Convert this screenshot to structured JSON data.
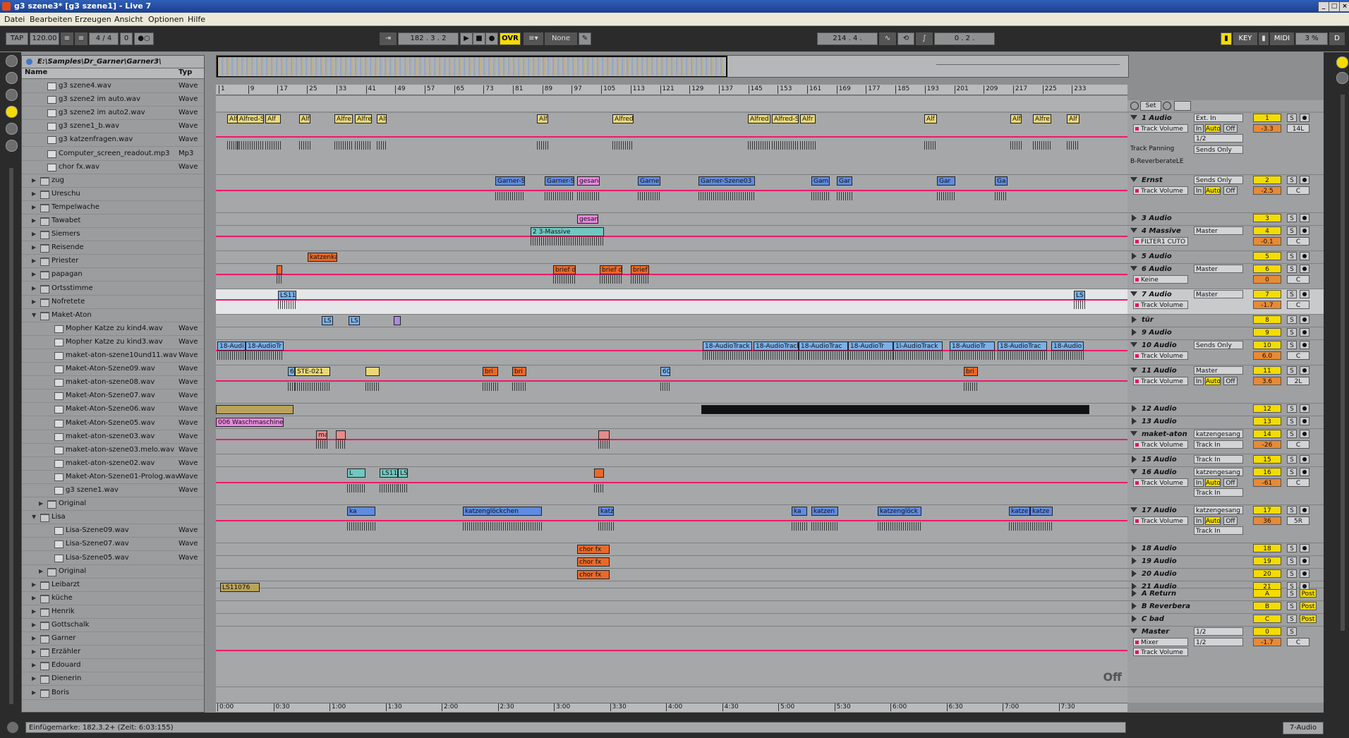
{
  "window": {
    "title": "g3 szene3*  [g3 szene1] - Live 7"
  },
  "menu": [
    "Datei",
    "Bearbeiten",
    "Erzeugen",
    "Ansicht",
    "Optionen",
    "Hilfe"
  ],
  "control": {
    "tap": "TAP",
    "tempo": "120.00",
    "signature": "4 / 4",
    "nudge": "0",
    "position": "182 .  3 .  2",
    "ovr": "OVR",
    "quantize": "None",
    "loop_start": "214 .  4 .",
    "loop_length": "0 .  2 .",
    "key": "KEY",
    "midi": "MIDI",
    "cpu": "3 %",
    "d": "D"
  },
  "browser": {
    "path": "E:\\Samples\\Dr_Garner\\Garner3\\",
    "col_name": "Name",
    "col_type": "Typ",
    "rows": [
      {
        "n": "g3 szene4.wav",
        "t": "Wave",
        "k": "file",
        "i": 2
      },
      {
        "n": "g3 szene2 im auto.wav",
        "t": "Wave",
        "k": "file",
        "i": 2
      },
      {
        "n": "g3 szene2 im auto2.wav",
        "t": "Wave",
        "k": "file",
        "i": 2
      },
      {
        "n": "g3 szene1_b.wav",
        "t": "Wave",
        "k": "file",
        "i": 2
      },
      {
        "n": "g3 katzenfragen.wav",
        "t": "Wave",
        "k": "file",
        "i": 2
      },
      {
        "n": "Computer_screen_readout.mp3",
        "t": "Mp3",
        "k": "file",
        "i": 2
      },
      {
        "n": "chor fx.wav",
        "t": "Wave",
        "k": "file",
        "i": 2
      },
      {
        "n": "zug",
        "t": "",
        "k": "fold",
        "i": 1
      },
      {
        "n": "Ureschu",
        "t": "",
        "k": "fold",
        "i": 1
      },
      {
        "n": "Tempelwache",
        "t": "",
        "k": "fold",
        "i": 1
      },
      {
        "n": "Tawabet",
        "t": "",
        "k": "fold",
        "i": 1
      },
      {
        "n": "Siemers",
        "t": "",
        "k": "fold",
        "i": 1
      },
      {
        "n": "Reisende",
        "t": "",
        "k": "fold",
        "i": 1
      },
      {
        "n": "Priester",
        "t": "",
        "k": "fold",
        "i": 1
      },
      {
        "n": "papagan",
        "t": "",
        "k": "fold",
        "i": 1
      },
      {
        "n": "Ortsstimme",
        "t": "",
        "k": "fold",
        "i": 1
      },
      {
        "n": "Nofretete",
        "t": "",
        "k": "fold",
        "i": 1
      },
      {
        "n": "Maket-Aton",
        "t": "",
        "k": "open",
        "i": 1
      },
      {
        "n": "Mopher Katze zu kind4.wav",
        "t": "Wave",
        "k": "file",
        "i": 3
      },
      {
        "n": "Mopher Katze zu kind3.wav",
        "t": "Wave",
        "k": "file",
        "i": 3
      },
      {
        "n": "maket-aton-szene10und11.wav",
        "t": "Wave",
        "k": "file",
        "i": 3
      },
      {
        "n": "Maket-Aton-Szene09.wav",
        "t": "Wave",
        "k": "file",
        "i": 3
      },
      {
        "n": "maket-aton-szene08.wav",
        "t": "Wave",
        "k": "file",
        "i": 3
      },
      {
        "n": "Maket-Aton-Szene07.wav",
        "t": "Wave",
        "k": "file",
        "i": 3
      },
      {
        "n": "Maket-Aton-Szene06.wav",
        "t": "Wave",
        "k": "file",
        "i": 3
      },
      {
        "n": "Maket-Aton-Szene05.wav",
        "t": "Wave",
        "k": "file",
        "i": 3
      },
      {
        "n": "maket-aton-szene03.wav",
        "t": "Wave",
        "k": "file",
        "i": 3
      },
      {
        "n": "maket-aton-szene03.melo.wav",
        "t": "Wave",
        "k": "file",
        "i": 3
      },
      {
        "n": "maket-aton-szene02.wav",
        "t": "Wave",
        "k": "file",
        "i": 3
      },
      {
        "n": "Maket-Aton-Szene01-Prolog.wav",
        "t": "Wave",
        "k": "file",
        "i": 3
      },
      {
        "n": "g3 szene1.wav",
        "t": "Wave",
        "k": "file",
        "i": 3
      },
      {
        "n": "Original",
        "t": "",
        "k": "fold",
        "i": 2
      },
      {
        "n": "Lisa",
        "t": "",
        "k": "open",
        "i": 1
      },
      {
        "n": "Lisa-Szene09.wav",
        "t": "Wave",
        "k": "file",
        "i": 3
      },
      {
        "n": "Lisa-Szene07.wav",
        "t": "Wave",
        "k": "file",
        "i": 3
      },
      {
        "n": "Lisa-Szene05.wav",
        "t": "Wave",
        "k": "file",
        "i": 3
      },
      {
        "n": "Original",
        "t": "",
        "k": "fold",
        "i": 2
      },
      {
        "n": "Leibarzt",
        "t": "",
        "k": "fold",
        "i": 1
      },
      {
        "n": "küche",
        "t": "",
        "k": "fold",
        "i": 1
      },
      {
        "n": "Henrik",
        "t": "",
        "k": "fold",
        "i": 1
      },
      {
        "n": "Gottschalk",
        "t": "",
        "k": "fold",
        "i": 1
      },
      {
        "n": "Garner",
        "t": "",
        "k": "fold",
        "i": 1
      },
      {
        "n": "Erzähler",
        "t": "",
        "k": "fold",
        "i": 1
      },
      {
        "n": "Edouard",
        "t": "",
        "k": "fold",
        "i": 1
      },
      {
        "n": "Dienerin",
        "t": "",
        "k": "fold",
        "i": 1
      },
      {
        "n": "Boris",
        "t": "",
        "k": "fold",
        "i": 1
      }
    ]
  },
  "ruler_bars": [
    "1",
    "9",
    "17",
    "25",
    "33",
    "41",
    "49",
    "57",
    "65",
    "73",
    "81",
    "89",
    "97",
    "105",
    "113",
    "121",
    "129",
    "137",
    "145",
    "153",
    "161",
    "169",
    "177",
    "185",
    "193",
    "201",
    "209",
    "217",
    "225",
    "233"
  ],
  "time_ruler": [
    "0:00",
    "0:30",
    "1:00",
    "1:30",
    "2:00",
    "2:30",
    "3:00",
    "3:30",
    "4:00",
    "4:30",
    "5:00",
    "5:30",
    "6:00",
    "6:30",
    "7:00",
    "7:30"
  ],
  "set_label": "Set",
  "tracks": [
    {
      "name": "1 Audio",
      "h": 88,
      "num": "1",
      "io": "Ext. In",
      "io2": "1/2",
      "vol": "-3.3",
      "pan": "14L",
      "auto": "Track Volume",
      "mon": true,
      "extra": [
        "Track Panning",
        "B-ReverberateLE"
      ],
      "sends": "Sends Only",
      "clips": [
        [
          "Alf",
          16,
          18,
          "#e9d87a"
        ],
        [
          "Alfred-S",
          30,
          38,
          "#e9d87a"
        ],
        [
          "Alf",
          70,
          22,
          "#e9d87a"
        ],
        [
          "Alf",
          118,
          16,
          "#e9d87a"
        ],
        [
          "Alfre",
          168,
          26,
          "#e9d87a"
        ],
        [
          "Alfre",
          197,
          24,
          "#e9d87a"
        ],
        [
          "Alf",
          228,
          14,
          "#e9d87a"
        ],
        [
          "Alf",
          455,
          16,
          "#e9d87a"
        ],
        [
          "Alfred",
          562,
          30,
          "#e9d87a"
        ],
        [
          "Alfred",
          754,
          32,
          "#e9d87a"
        ],
        [
          "Alfred-S",
          788,
          38,
          "#e9d87a"
        ],
        [
          "Alfr",
          828,
          22,
          "#e9d87a"
        ],
        [
          "Alf",
          1004,
          18,
          "#e9d87a"
        ],
        [
          "Alf",
          1126,
          16,
          "#e9d87a"
        ],
        [
          "Alfre",
          1158,
          26,
          "#e9d87a"
        ],
        [
          "Alf",
          1206,
          18,
          "#e9d87a"
        ]
      ]
    },
    {
      "name": "Ernst",
      "h": 54,
      "num": "2",
      "io": "Sends Only",
      "vol": "-2.5",
      "pan": "C",
      "auto": "Track Volume",
      "mon": true,
      "clips": [
        [
          "Garner-S",
          396,
          42,
          "#5f8be0"
        ],
        [
          "Garner-S",
          466,
          42,
          "#5f8be0"
        ],
        [
          "gesang",
          512,
          32,
          "#e88adf"
        ],
        [
          "Garne",
          598,
          32,
          "#5f8be0"
        ],
        [
          "Garner-Szene03",
          684,
          80,
          "#5f8be0"
        ],
        [
          "Gam",
          844,
          26,
          "#5f8be0"
        ],
        [
          "Gar",
          880,
          22,
          "#5f8be0"
        ],
        [
          "Gar",
          1022,
          26,
          "#5f8be0"
        ],
        [
          "Ga",
          1104,
          18,
          "#5f8be0"
        ]
      ]
    },
    {
      "name": "3 Audio",
      "h": 18,
      "num": "3",
      "io": "",
      "clips": [
        [
          "gesan",
          512,
          30,
          "#e88adf"
        ]
      ]
    },
    {
      "name": "4 Massive",
      "h": 36,
      "num": "4",
      "io": "Master",
      "vol": "-0.1",
      "pan": "C",
      "auto": "FILTER1 CUTO",
      "clips": [
        [
          "2 3-Massive",
          446,
          104,
          "#6fc8c0"
        ]
      ]
    },
    {
      "name": "5 Audio",
      "h": 18,
      "num": "5",
      "io": "",
      "clips": [
        [
          "katzenkatze",
          130,
          42,
          "#e8692a"
        ]
      ]
    },
    {
      "name": "6 Audio",
      "h": 36,
      "num": "6",
      "io": "Master",
      "vol": "0",
      "pan": "C",
      "auto": "Keine",
      "clips": [
        [
          "",
          86,
          8,
          "#e8692a"
        ],
        [
          "brief d",
          478,
          32,
          "#e8692a"
        ],
        [
          "brief d",
          544,
          32,
          "#e8692a"
        ],
        [
          "brief",
          588,
          26,
          "#e8692a"
        ]
      ]
    },
    {
      "name": "7 Audio",
      "h": 36,
      "num": "7",
      "io": "Master",
      "vol": "-1.7",
      "pan": "C",
      "auto": "Track Volume",
      "sel": true,
      "clips": [
        [
          "LS11",
          88,
          26,
          "#7ab0e8"
        ],
        [
          "LS",
          1216,
          16,
          "#7ab0e8"
        ]
      ]
    },
    {
      "name": "tür",
      "h": 18,
      "num": "8",
      "io": "",
      "clips": [
        [
          "LS",
          150,
          16,
          "#7ab0e8"
        ],
        [
          "LS",
          188,
          16,
          "#7ab0e8"
        ],
        [
          "",
          252,
          10,
          "#a98be0"
        ]
      ]
    },
    {
      "name": "9 Audio",
      "h": 18,
      "num": "9",
      "io": "",
      "clips": []
    },
    {
      "name": "10 Audio",
      "h": 36,
      "num": "10",
      "io": "Sends Only",
      "vol": "6.0",
      "pan": "C",
      "auto": "Track Volume",
      "clips": [
        [
          "18-Audi",
          2,
          40,
          "#7ab0e8"
        ],
        [
          "18-AudioTr",
          42,
          54,
          "#7ab0e8"
        ],
        [
          "18-AudioTrack",
          690,
          70,
          "#7ab0e8"
        ],
        [
          "18-AudioTrack",
          762,
          64,
          "#7ab0e8"
        ],
        [
          "18-AudioTrac",
          826,
          70,
          "#7ab0e8"
        ],
        [
          "18-AudioTr",
          896,
          64,
          "#7ab0e8"
        ],
        [
          "1l-AudioTrack",
          960,
          70,
          "#7ab0e8"
        ],
        [
          "18-AudioTr",
          1040,
          64,
          "#7ab0e8"
        ],
        [
          "18-AudioTrac",
          1108,
          70,
          "#7ab0e8"
        ],
        [
          "18-Audio",
          1184,
          46,
          "#7ab0e8"
        ]
      ]
    },
    {
      "name": "11 Audio",
      "h": 54,
      "num": "11",
      "io": "Master",
      "vol": "3.6",
      "pan": "2L",
      "auto": "Track Volume",
      "mon": true,
      "clips": [
        [
          "60",
          102,
          10,
          "#7ab0e8"
        ],
        [
          "STE-021",
          112,
          50,
          "#e9d87a"
        ],
        [
          "",
          212,
          20,
          "#e9d87a"
        ],
        [
          "bri",
          378,
          22,
          "#e8692a"
        ],
        [
          "bri",
          420,
          20,
          "#e8692a"
        ],
        [
          "60",
          630,
          14,
          "#7ab0e8"
        ],
        [
          "bri",
          1060,
          20,
          "#e8692a"
        ]
      ]
    },
    {
      "name": "12 Audio",
      "h": 18,
      "num": "12",
      "io": "",
      "clips": [
        [
          "",
          0,
          110,
          "#b9a35a"
        ],
        [
          "",
          688,
          550,
          "#111"
        ]
      ]
    },
    {
      "name": "13 Audio",
      "h": 18,
      "num": "13",
      "io": "",
      "clips": [
        [
          "006 Waschmaschine",
          0,
          96,
          "#e88adf"
        ]
      ]
    },
    {
      "name": "maket-aton",
      "h": 36,
      "num": "14",
      "io": "katzengesang",
      "vol": "-26",
      "pan": "C",
      "auto": "Track Volume",
      "io2": "Track In",
      "clips": [
        [
          "ma",
          142,
          16,
          "#e88a8a"
        ],
        [
          "",
          170,
          14,
          "#e88a8a"
        ],
        [
          "",
          542,
          16,
          "#e88a8a"
        ]
      ]
    },
    {
      "name": "15 Audio",
      "h": 18,
      "num": "15",
      "io": "Track In",
      "clips": []
    },
    {
      "name": "16 Audio",
      "h": 54,
      "num": "16",
      "io": "katzengesang",
      "vol": "-61",
      "pan": "C",
      "auto": "Track Volume",
      "mon": true,
      "io2": "Track In",
      "clips": [
        [
          "L",
          186,
          26,
          "#6fc8c0"
        ],
        [
          "LS11",
          232,
          26,
          "#6fc8c0"
        ],
        [
          "LS",
          258,
          14,
          "#6fc8c0"
        ],
        [
          "",
          536,
          14,
          "#e8692a"
        ]
      ]
    },
    {
      "name": "17 Audio",
      "h": 54,
      "num": "17",
      "io": "katzengesang",
      "vol": "36",
      "pan": "5R",
      "auto": "Track Volume",
      "mon": true,
      "io2": "Track In",
      "clips": [
        [
          "ka",
          186,
          40,
          "#5f8be0"
        ],
        [
          "katzenglöckchen",
          350,
          112,
          "#5f8be0"
        ],
        [
          "katz",
          542,
          22,
          "#5f8be0"
        ],
        [
          "ka",
          816,
          22,
          "#5f8be0"
        ],
        [
          "katzen",
          844,
          38,
          "#5f8be0"
        ],
        [
          "katzenglöck",
          938,
          62,
          "#5f8be0"
        ],
        [
          "katze",
          1124,
          30,
          "#5f8be0"
        ],
        [
          "katze",
          1154,
          32,
          "#5f8be0"
        ]
      ]
    },
    {
      "name": "18 Audio",
      "h": 18,
      "num": "18",
      "io": "",
      "clips": [
        [
          "chor fx",
          512,
          46,
          "#e8692a"
        ]
      ]
    },
    {
      "name": "19 Audio",
      "h": 18,
      "num": "19",
      "io": "",
      "clips": [
        [
          "chor fx",
          512,
          46,
          "#e8692a"
        ]
      ]
    },
    {
      "name": "20 Audio",
      "h": 18,
      "num": "20",
      "io": "",
      "clips": [
        [
          "chor fx",
          512,
          46,
          "#e8692a"
        ]
      ]
    },
    {
      "name": "21 Audio",
      "h": 10,
      "num": "21",
      "io": "",
      "clips": [
        [
          "LS11076",
          6,
          56,
          "#b9a35a"
        ]
      ]
    },
    {
      "name": "A Return",
      "h": 18,
      "num": "A",
      "io": "",
      "post": "Post",
      "clips": []
    },
    {
      "name": "B Reverbera",
      "h": 18,
      "num": "B",
      "io": "",
      "post": "Post",
      "clips": []
    },
    {
      "name": "C bad",
      "h": 18,
      "num": "C",
      "io": "",
      "post": "Post",
      "clips": []
    },
    {
      "name": "Master",
      "h": 86,
      "num": "0",
      "io": "1/2",
      "vol": "-1.7",
      "pan": "C",
      "auto": "Mixer",
      "io2": "1/2",
      "master": true,
      "clips": []
    }
  ],
  "master_off": "Off",
  "toggles": {
    "in": "In",
    "auto": "Auto",
    "off": "Off",
    "s": "S"
  },
  "status": {
    "text": "Einfügemarke: 182.3.2+ (Zeit: 6:03:155)",
    "track": "7-Audio"
  },
  "colors": {
    "envelope": "#f0186a",
    "clip_yellow": "#e9d87a",
    "clip_blue": "#5f8be0",
    "clip_orange": "#e8692a",
    "track_num": "#f4dc00"
  }
}
